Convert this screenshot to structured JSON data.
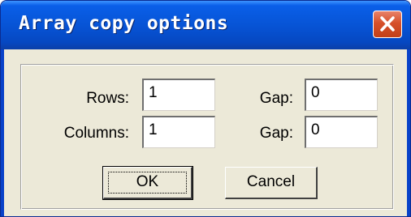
{
  "window": {
    "title": "Array copy options"
  },
  "titlebar": {
    "close_icon": "close-icon"
  },
  "form": {
    "rows_label": "Rows:",
    "rows_value": "1",
    "rows_gap_label": "Gap:",
    "rows_gap_value": "0",
    "columns_label": "Columns:",
    "columns_value": "1",
    "columns_gap_label": "Gap:",
    "columns_gap_value": "0"
  },
  "buttons": {
    "ok_label": "OK",
    "cancel_label": "Cancel"
  }
}
